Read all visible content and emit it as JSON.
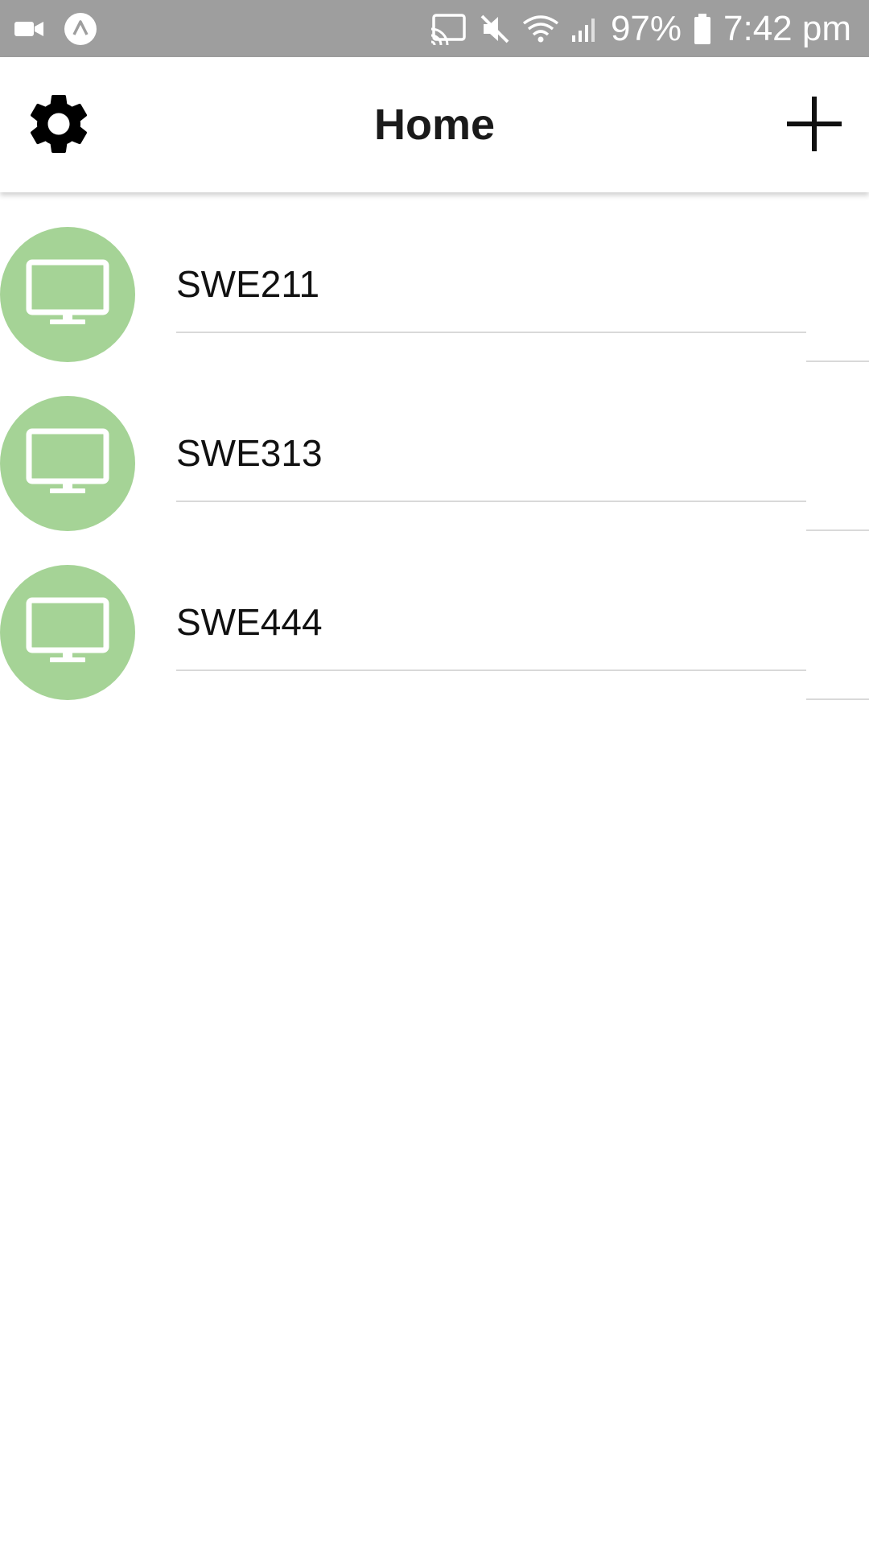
{
  "status_bar": {
    "icons_left": [
      "video-camera-icon",
      "app-notification-icon"
    ],
    "icons_right": [
      "cast-icon",
      "mute-icon",
      "wifi-icon",
      "signal-icon",
      "battery-icon"
    ],
    "battery": "97%",
    "time": "7:42 pm"
  },
  "header": {
    "title": "Home",
    "settings_icon": "gear-icon",
    "add_icon": "plus-icon"
  },
  "devices": [
    {
      "label": "SWE211",
      "icon": "monitor-icon"
    },
    {
      "label": "SWE313",
      "icon": "monitor-icon"
    },
    {
      "label": "SWE444",
      "icon": "monitor-icon"
    }
  ],
  "colors": {
    "status_bar": "#9e9e9e",
    "avatar_bg": "#a5d396",
    "divider": "#d9d9d9",
    "title": "#1a1a1a"
  }
}
